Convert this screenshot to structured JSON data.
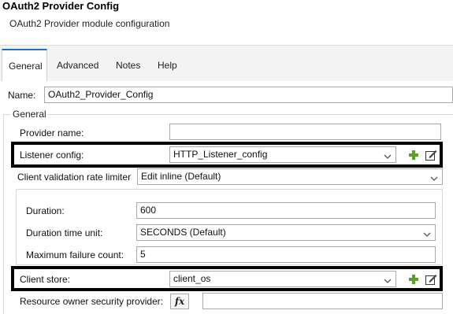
{
  "header": {
    "title": "OAuth2 Provider Config",
    "subtitle": "OAuth2 Provider module configuration"
  },
  "tabs": [
    {
      "label": "General",
      "active": true
    },
    {
      "label": "Advanced",
      "active": false
    },
    {
      "label": "Notes",
      "active": false
    },
    {
      "label": "Help",
      "active": false
    }
  ],
  "name_field": {
    "label": "Name:",
    "value": "OAuth2_Provider_Config"
  },
  "general_group": {
    "title": "General"
  },
  "provider_name": {
    "label": "Provider name:",
    "value": ""
  },
  "listener_config": {
    "label": "Listener config:",
    "value": "HTTP_Listener_config"
  },
  "rate_limiter": {
    "label": "Client validation rate limiter",
    "value": "Edit inline (Default)"
  },
  "duration": {
    "label": "Duration:",
    "value": "600"
  },
  "duration_unit": {
    "label": "Duration time unit:",
    "value": "SECONDS (Default)"
  },
  "max_failure": {
    "label": "Maximum failure count:",
    "value": "5"
  },
  "client_store": {
    "label": "Client store:",
    "value": "client_os"
  },
  "resource_owner": {
    "label": "Resource owner security provider:",
    "fx_label": "fx",
    "value": ""
  },
  "colors": {
    "accent": "#1f6fc7",
    "add_icon": "#5aa02c",
    "highlight_border": "#000000"
  }
}
